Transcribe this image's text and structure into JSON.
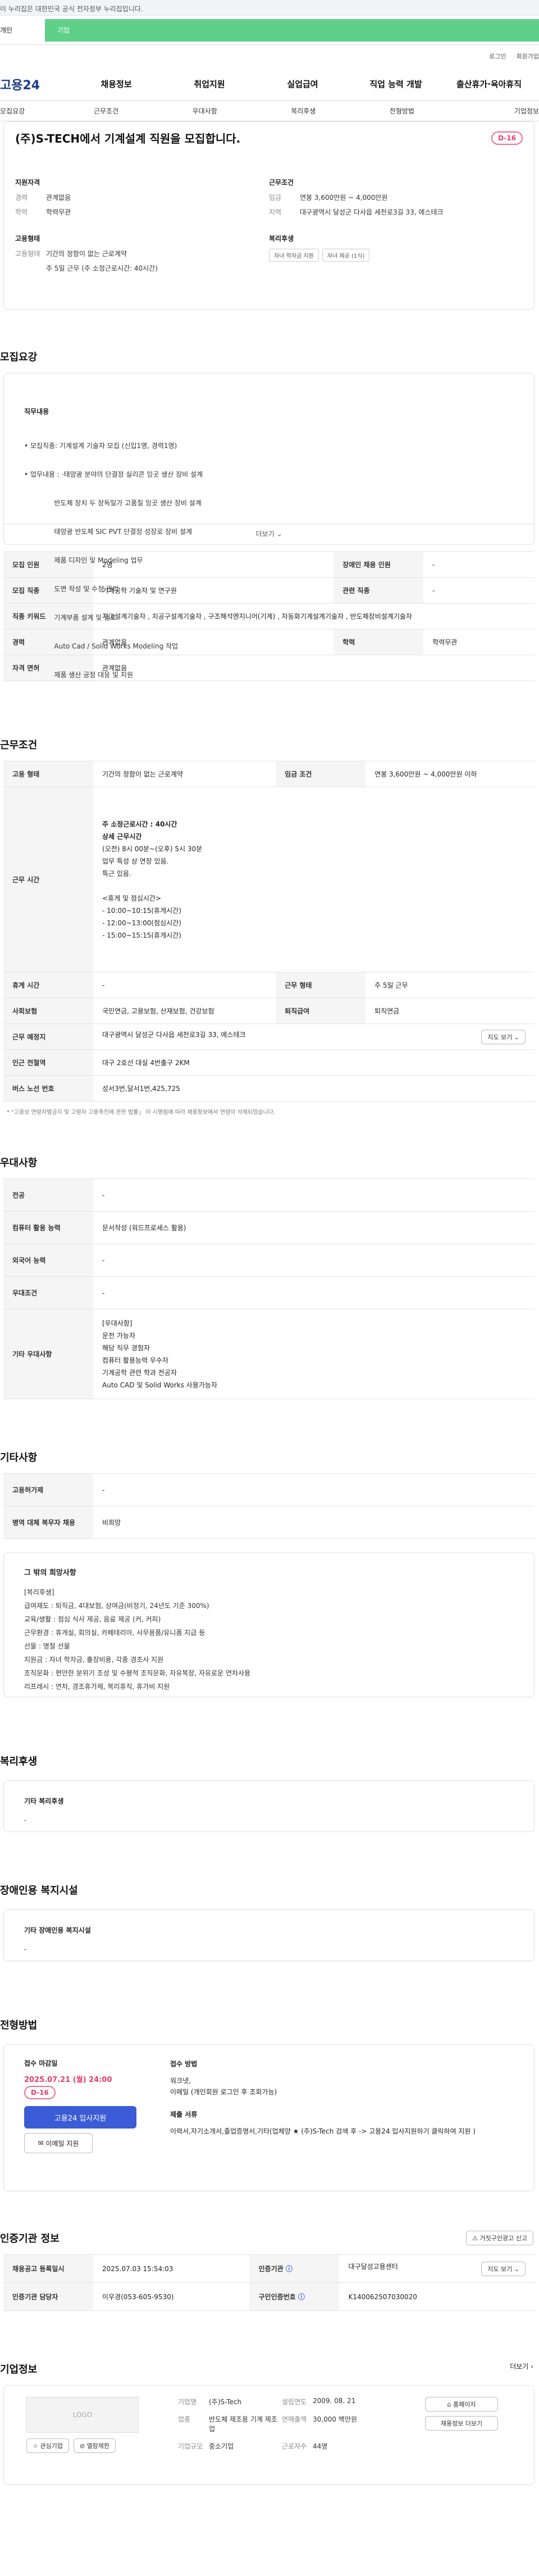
{
  "gov_notice": "이 누리집은 대한민국 공식 전자정부 누리집입니다.",
  "topbar": {
    "left": "개인",
    "right": "기업"
  },
  "util": [
    "로그인",
    "회원가입"
  ],
  "logo": "고용24",
  "gnb": [
    "채용정보",
    "취업지원",
    "실업급여",
    "직업 능력 개발",
    "출산휴가·육아휴직"
  ],
  "subnav": [
    "모집요강",
    "근무조건",
    "우대사항",
    "복리후생",
    "전형방법",
    "기업정보"
  ],
  "summary": {
    "title": "(주)S-TECH에서 기계설계 직원을 모집합니다.",
    "dday": "D-16",
    "req_label": "지원자격",
    "career_k": "경력",
    "career_v": "관계없음",
    "edu_k": "학력",
    "edu_v": "학력무관",
    "emp_label": "고용형태",
    "emptype_k": "고용형태",
    "emptype_v": "기간의 정함이 없는 근로계약",
    "hours_v": "주 5일 근무 (주 소정근로시간: 40시간)",
    "cond_label": "근무조건",
    "wage_k": "임금",
    "wage_v": "연봉 3,600만원 ~ 4,000만원",
    "loc_k": "지역",
    "loc_v": "대구광역시 달성군 다사읍 세천로3길 33, 에스테크",
    "welfare_label": "복리후생",
    "welfare": [
      "자녀 학자금 지원",
      "자녀 제공 (1식)"
    ]
  },
  "recruit": {
    "heading": "모집요강",
    "job_label": "직무내용",
    "lines": [
      "• 모집직종: 기계설계 기술자 모집 (신입1명, 경력1명)",
      "• 업무내용 : ·태양광 분야의 단결정 실리콘 잉곳 생산 장비 설계",
      "              반도체 장치 두 장독일가 고품질 잉곳 생산 장비 설계",
      "              태양광 반도체 SIC PVT 단결정 성장로 장비 설계",
      "              제품 디자인 및 Modeling 업무",
      "              도면 작성 및 수정 관리",
      "              기계부품 설계 및 검토",
      "              Auto Cad / Solid Works Modeling 작업",
      "              제품 생산 공정 대응 및 지원"
    ],
    "more": "더보기",
    "rows": [
      [
        "모집 인원",
        "2명",
        "장애인 채용 인원",
        "-"
      ],
      [
        "모집 직종",
        "기계공학 기술자 및 연구원",
        "관련 직종",
        "-"
      ],
      [
        "직종 키워드",
        "지그설계기술자 , 치공구설계기술자 , 구조해석엔지니어(기계) , 자동화기계설계기술자 , 반도체장비설계기술자"
      ],
      [
        "경력",
        "관계없음",
        "학력",
        "학력무관"
      ],
      [
        "자격 면허",
        "관계없음"
      ]
    ]
  },
  "work": {
    "heading": "근무조건",
    "type_k": "고용 형태",
    "type_v": "기간의 정함이 없는 근로계약",
    "wage_k": "임금 조건",
    "wage_v": "연봉 3,600만원 ~ 4,000만원 이하",
    "time_k": "근무 시간",
    "time_lines": [
      "주 소정근로시간 : 40시간",
      "",
      "상세 근무시간",
      "(오전) 8시 00분~(오후) 5시 30분",
      "업무 특성 상 연장 있음.",
      "특근 있음.",
      "",
      "<휴게 및 점심시간>",
      "- 10:00~10:15(휴게시간)",
      "- 12:00~13:00(점심시간)",
      "- 15:00~15:15(휴게시간)"
    ],
    "rest_k": "휴게 시간",
    "rest_v": "-",
    "form_k": "근무 형태",
    "form_v": "주 5일 근무",
    "ins_k": "사회보험",
    "ins_v": "국민연금, 고용보험, 산재보험, 건강보험",
    "ret_k": "퇴직급여",
    "ret_v": "퇴직연금",
    "place_k": "근무 예정지",
    "place_v": "대구광역시 달성군 다사읍 세천로3길 33, 에스테크",
    "map": "지도 보기",
    "sub_k": "인근 전철역",
    "sub_v": "대구 2호선 대실 4번출구 2KM",
    "bus_k": "버스 노선 번호",
    "bus_v": "성서3번,달서1번,425,725",
    "note": "* \"고용상 연령차별금지 및 고령자 고용촉진에 관한 법률」 이 시행됨에 따라 채용정보에서 연령이 삭제되었습니다."
  },
  "pref": {
    "heading": "우대사항",
    "rows": [
      [
        "전공",
        "-"
      ],
      [
        "컴퓨터 활용 능력",
        "문서작성 (워드프로세스 활용)"
      ],
      [
        "외국어 능력",
        "-"
      ],
      [
        "우대조건",
        "-"
      ]
    ],
    "etc_k": "기타 우대사항",
    "etc": [
      "[우대사항]",
      "운전 가능자",
      "해당 직무 경험자",
      "컴퓨터 활용능력 우수자",
      "기계공학 관련 학과 전공자",
      "Auto CAD 및 Solid Works 사용가능자"
    ]
  },
  "misc": {
    "heading": "기타사항",
    "rows": [
      [
        "고용허가제",
        "-"
      ],
      [
        "병역 대체 복무자 채용",
        "비희망"
      ]
    ],
    "box_title": "그 밖의 희망사항",
    "lines": [
      "[복리후생]",
      "급여제도 : 퇴직금, 4대보험, 상여금(비정기, 24년도 기준 300%)",
      "교육/생활 : 점심 식사 제공, 음료 제공 (커, 커피)",
      "근무환경 : 휴게실, 회의실, 카페테리아, 사무용품/유니폼 지급 등",
      "선물 : 명절 선물",
      "지원금 : 자녀 학자금, 출장비용, 각종 경조사 지원",
      "조직문화 : 편안한 분위기 조성 및 수평적 조직문화, 자유복장, 자유로운 연차사용",
      "리프레시 : 연차, 경조휴가제, 복리휴직, 휴가비 지원"
    ]
  },
  "benefit": {
    "heading": "복리후생",
    "label": "기타 복리후생",
    "value": "-"
  },
  "disab": {
    "heading": "장애인용 복지시설",
    "label": "기타 장애인용 복지시설",
    "value": "-"
  },
  "apply": {
    "heading": "전형방법",
    "deadline_label": "접수 마감일",
    "deadline": "2025.07.21 (월) 24:00",
    "dday": "D-16",
    "apply_btn": "고용24 입사지원",
    "email_btn": "이메일 지원",
    "method_label": "접수 방법",
    "methods": [
      "워크넷,",
      "이메일 (개인회원 로그인 후 조회가능)"
    ],
    "doc_label": "제출 서류",
    "docs": "이력서,자기소개서,졸업증명서,기타(업체양 ★ (주)S-Tech 검색 후 -> 고용24 입사지원하기 클릭하여 지원 )"
  },
  "cert": {
    "heading": "인증기관 정보",
    "report": "거짓구인광고 신고",
    "rows": [
      [
        "채용공고 등록일시",
        "2025.07.03 15:54:03",
        "인증기관",
        "대구달성고용센터"
      ],
      [
        "인증기관 담당자",
        "이우경(053-605-9530)",
        "구인인증번호",
        "K140062507030020"
      ]
    ],
    "map": "지도 보기"
  },
  "company": {
    "heading": "기업정보",
    "more": "더보기",
    "logo": "LOGO",
    "fav": "관심기업",
    "block": "열람제한",
    "kv": [
      [
        "기업명",
        "(주)S-Tech",
        "설립연도",
        "2009. 08. 21"
      ],
      [
        "업종",
        "반도체 제조용 기계 제조업",
        "연매출액",
        "30,000 백만원"
      ],
      [
        "기업규모",
        "중소기업",
        "근로자수",
        "44명"
      ]
    ],
    "home": "홈페이지",
    "other": "채용정보 더보기"
  }
}
